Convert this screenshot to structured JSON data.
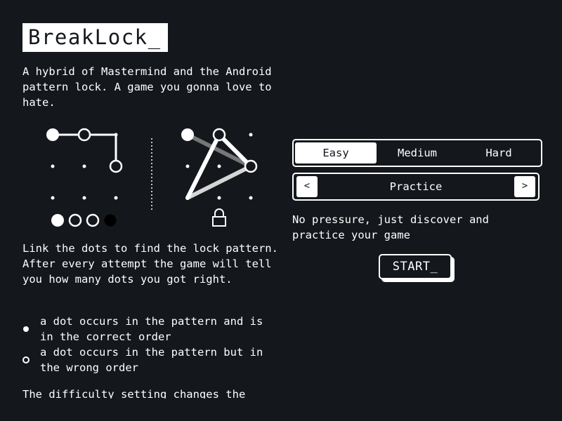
{
  "app": {
    "logo": "BreakLock_",
    "intro": "A hybrid of Mastermind and the Android pattern lock. A game you gonna love to hate."
  },
  "instructions": {
    "howto": "Link the dots to find the lock pattern. After every attempt the game will tell you how many dots you got right.",
    "legend": [
      {
        "icon": "filled-dot-icon",
        "text": "a dot occurs in the pattern and is in the correct order"
      },
      {
        "icon": "hollow-dot-icon",
        "text": "a dot occurs in the pattern but in the wrong order"
      }
    ],
    "more": "The difficulty setting changes the"
  },
  "illustration": {
    "example_feedback": [
      "full",
      "hollow",
      "hollow",
      "empty"
    ],
    "lock_icon": "lock-icon"
  },
  "difficulty": {
    "options": [
      "Easy",
      "Medium",
      "Hard"
    ],
    "selected": "Easy"
  },
  "mode": {
    "prev": "<",
    "label": "Practice",
    "next": ">",
    "description": "No pressure, just discover and practice your game"
  },
  "start": {
    "label": "START_"
  },
  "colors": {
    "background": "#14171c",
    "foreground": "#ffffff",
    "muted_line": "#777777"
  }
}
